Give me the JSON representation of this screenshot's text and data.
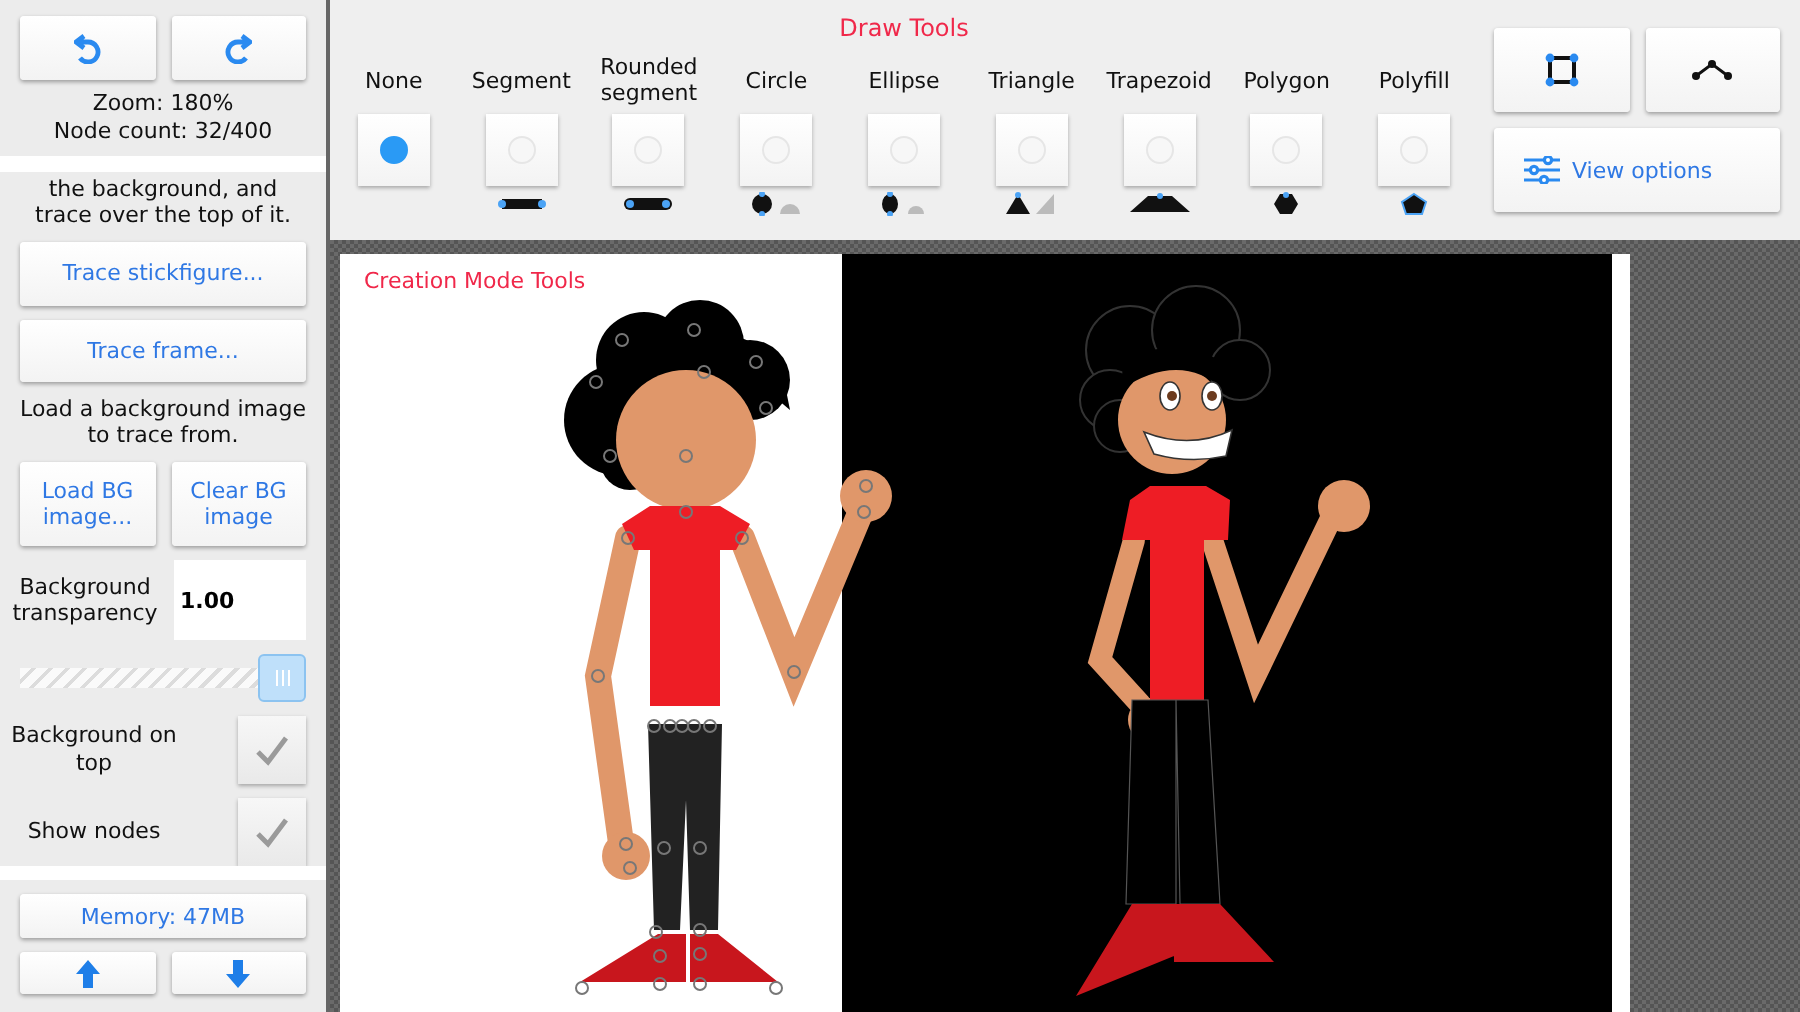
{
  "history": {
    "zoom": "Zoom: 180%",
    "node_count": "Node count: 32/400"
  },
  "trace_panel": {
    "intro": "the background, and trace over the top of it.",
    "buttons": [
      "Trace stickfigure...",
      "Trace frame..."
    ],
    "bg_hint": "Load a background image to trace from.",
    "bg_buttons": [
      "Load BG image...",
      "Clear BG image"
    ],
    "transparency": {
      "label": "Background transparency",
      "value": "1.00",
      "level": 1
    },
    "options": [
      {
        "label": "Background on top",
        "checked": true
      },
      {
        "label": "Show nodes",
        "checked": true
      }
    ]
  },
  "memory": "Memory: 47MB",
  "draw_tools": {
    "title": "Draw Tools",
    "tools": [
      {
        "label": "None",
        "kind": "none",
        "selected": true
      },
      {
        "label": "Segment",
        "kind": "segment",
        "selected": false
      },
      {
        "label": "Rounded segment",
        "kind": "rounded",
        "selected": false
      },
      {
        "label": "Circle",
        "kind": "circle",
        "selected": false
      },
      {
        "label": "Ellipse",
        "kind": "ellipse",
        "selected": false
      },
      {
        "label": "Triangle",
        "kind": "triangle",
        "selected": false
      },
      {
        "label": "Trapezoid",
        "kind": "trapezoid",
        "selected": false
      },
      {
        "label": "Polygon",
        "kind": "polygon",
        "selected": false
      },
      {
        "label": "Polyfill",
        "kind": "polyfill",
        "selected": false
      }
    ]
  },
  "view_options": "View options",
  "canvas": {
    "label": "Creation Mode Tools"
  }
}
